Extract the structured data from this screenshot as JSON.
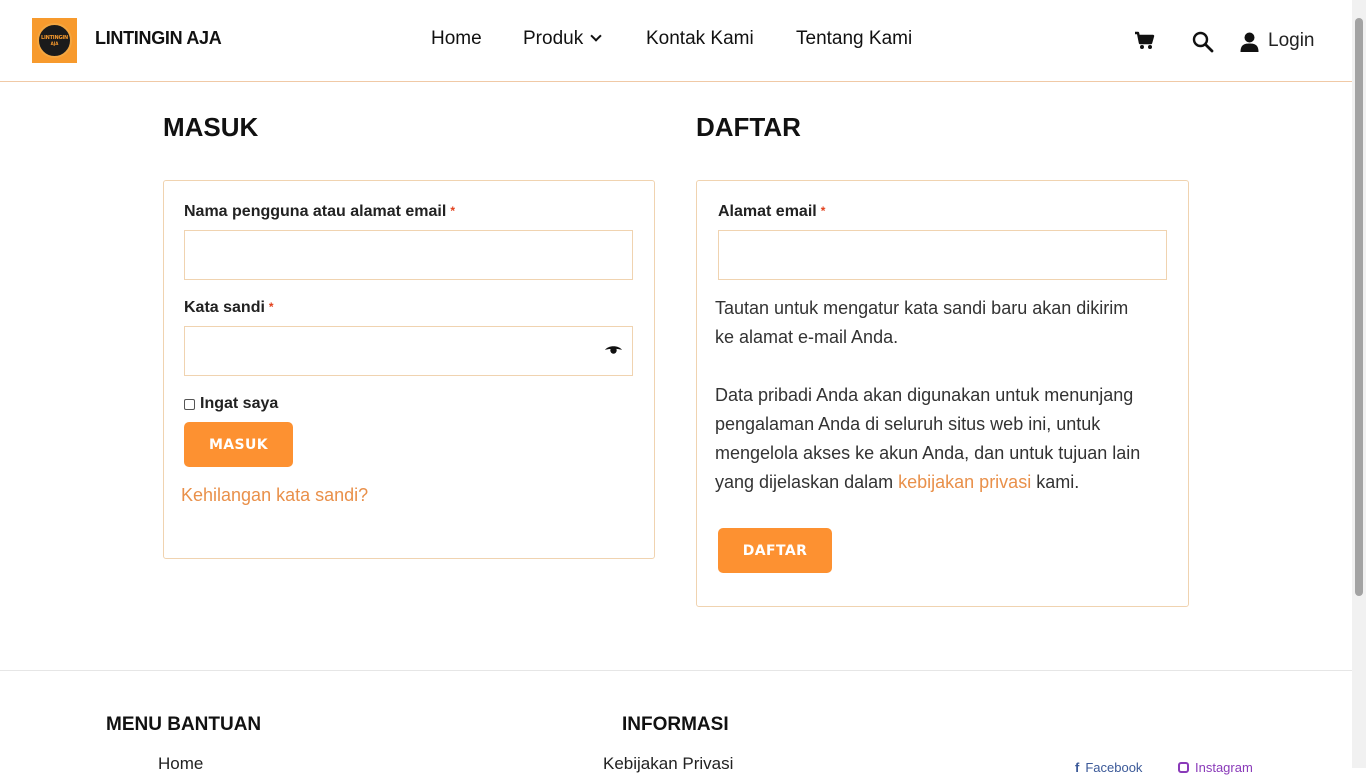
{
  "header": {
    "logo_text_top": "LINTINGIN",
    "logo_text_bottom": "AJA",
    "brand": "LINTINGIN AJA",
    "nav": [
      "Home",
      "Produk",
      "Kontak Kami",
      "Tentang Kami"
    ],
    "login_label": "Login",
    "icons": [
      "cart-icon",
      "search-icon",
      "user-icon"
    ]
  },
  "login": {
    "title": "MASUK",
    "username_label": "Nama pengguna atau alamat email",
    "username_value": "",
    "password_label": "Kata sandi",
    "password_value": "",
    "required_mark": "*",
    "remember_label": "Ingat saya",
    "submit_label": "MASUK",
    "lost_password": "Kehilangan kata sandi?"
  },
  "register": {
    "title": "DAFTAR",
    "email_label": "Alamat email",
    "email_value": "",
    "required_mark": "*",
    "info_line1": "Tautan untuk mengatur kata sandi baru akan dikirim",
    "info_line2": "ke alamat e-mail Anda.",
    "privacy_line1": "Data pribadi Anda akan digunakan untuk menunjang",
    "privacy_line2": "pengalaman Anda di seluruh situs web ini, untuk",
    "privacy_line3": "mengelola akses ke akun Anda, dan untuk tujuan lain",
    "privacy_line4_pre": "yang dijelaskan dalam ",
    "privacy_link": "kebijakan privasi",
    "privacy_line4_post": " kami.",
    "submit_label": "DAFTAR"
  },
  "footer": {
    "menu_title": "MENU BANTUAN",
    "menu_first_item": "Home",
    "info_title": "INFORMASI",
    "info_first_item": "Kebijakan Privasi",
    "social_facebook": "Facebook",
    "social_instagram": "Instagram"
  },
  "colors": {
    "accent": "#fd9131",
    "link": "#e9904a",
    "border": "#f0d3b0",
    "required": "#e2401c"
  }
}
